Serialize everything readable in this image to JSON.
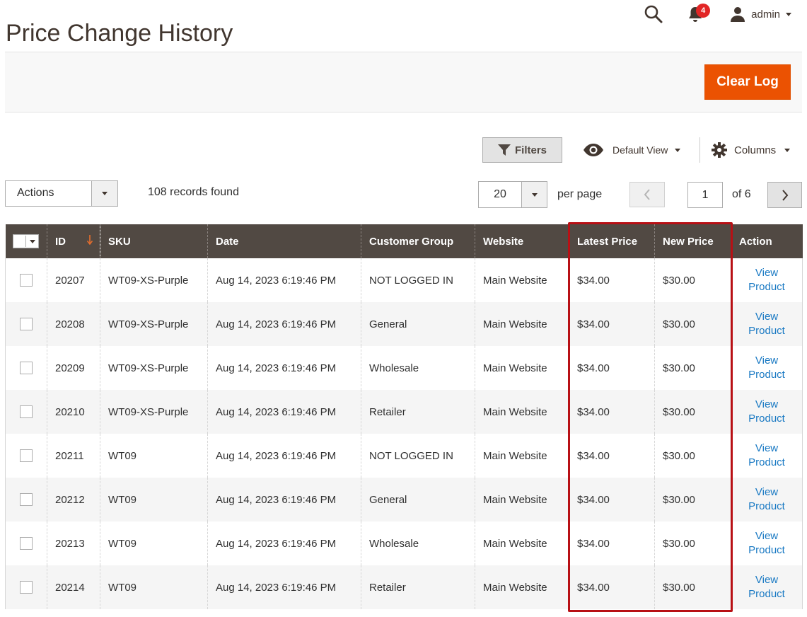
{
  "page": {
    "title": "Price Change History"
  },
  "header": {
    "notifications_count": "4",
    "user_name": "admin"
  },
  "action_bar": {
    "clear_log_label": "Clear Log",
    "accent_color": "#eb5202"
  },
  "toolbar": {
    "filters_label": "Filters",
    "view_label": "Default View",
    "columns_label": "Columns",
    "actions_label": "Actions",
    "records_found": "108 records found",
    "per_page_value": "20",
    "per_page_label": "per page",
    "current_page": "1",
    "of_pages": "of 6"
  },
  "grid": {
    "columns": [
      "ID",
      "SKU",
      "Date",
      "Customer Group",
      "Website",
      "Latest Price",
      "New Price",
      "Action"
    ],
    "sort_column": "ID",
    "sort_direction": "descending",
    "header_color": "#514943",
    "highlight_color": "#b81015",
    "link_color": "#1979c3",
    "rows": [
      {
        "id": "20207",
        "sku": "WT09-XS-Purple",
        "date": "Aug 14, 2023 6:19:46 PM",
        "group": "NOT LOGGED IN",
        "website": "Main Website",
        "latest_price": "$34.00",
        "new_price": "$30.00",
        "action_line1": "View",
        "action_line2": "Product"
      },
      {
        "id": "20208",
        "sku": "WT09-XS-Purple",
        "date": "Aug 14, 2023 6:19:46 PM",
        "group": "General",
        "website": "Main Website",
        "latest_price": "$34.00",
        "new_price": "$30.00",
        "action_line1": "View",
        "action_line2": "Product"
      },
      {
        "id": "20209",
        "sku": "WT09-XS-Purple",
        "date": "Aug 14, 2023 6:19:46 PM",
        "group": "Wholesale",
        "website": "Main Website",
        "latest_price": "$34.00",
        "new_price": "$30.00",
        "action_line1": "View",
        "action_line2": "Product"
      },
      {
        "id": "20210",
        "sku": "WT09-XS-Purple",
        "date": "Aug 14, 2023 6:19:46 PM",
        "group": "Retailer",
        "website": "Main Website",
        "latest_price": "$34.00",
        "new_price": "$30.00",
        "action_line1": "View",
        "action_line2": "Product"
      },
      {
        "id": "20211",
        "sku": "WT09",
        "date": "Aug 14, 2023 6:19:46 PM",
        "group": "NOT LOGGED IN",
        "website": "Main Website",
        "latest_price": "$34.00",
        "new_price": "$30.00",
        "action_line1": "View",
        "action_line2": "Product"
      },
      {
        "id": "20212",
        "sku": "WT09",
        "date": "Aug 14, 2023 6:19:46 PM",
        "group": "General",
        "website": "Main Website",
        "latest_price": "$34.00",
        "new_price": "$30.00",
        "action_line1": "View",
        "action_line2": "Product"
      },
      {
        "id": "20213",
        "sku": "WT09",
        "date": "Aug 14, 2023 6:19:46 PM",
        "group": "Wholesale",
        "website": "Main Website",
        "latest_price": "$34.00",
        "new_price": "$30.00",
        "action_line1": "View",
        "action_line2": "Product"
      },
      {
        "id": "20214",
        "sku": "WT09",
        "date": "Aug 14, 2023 6:19:46 PM",
        "group": "Retailer",
        "website": "Main Website",
        "latest_price": "$34.00",
        "new_price": "$30.00",
        "action_line1": "View",
        "action_line2": "Product"
      }
    ]
  }
}
